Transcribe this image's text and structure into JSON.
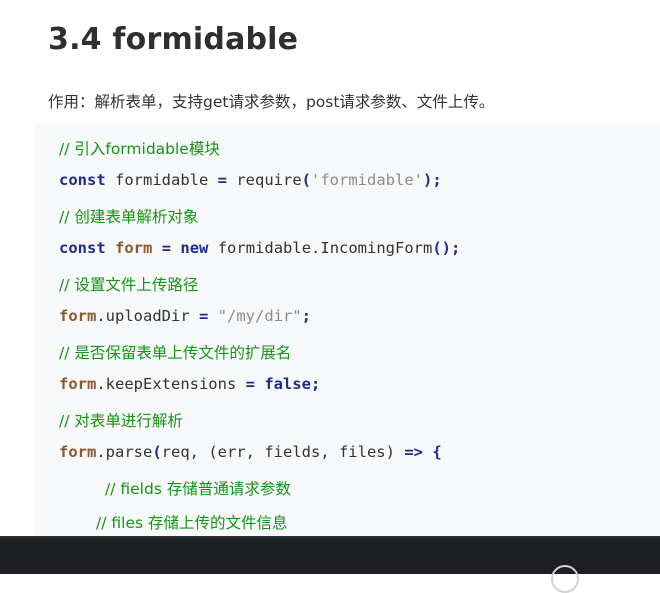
{
  "title": "3.4 formidable",
  "intro": "作用：解析表单，支持get请求参数，post请求参数、文件上传。",
  "code": {
    "c1": "// 引入formidable模块",
    "l1": {
      "kw": "const",
      "a": " formidable ",
      "op": "=",
      "b": " require",
      "paren_open": "(",
      "str": "'formidable'",
      "paren_close": ")",
      "semi": ";"
    },
    "c2": "// 创建表单解析对象",
    "l2": {
      "kw1": "const",
      "id": "form",
      "op": "=",
      "kw2": "new",
      "rest": " formidable.IncomingForm",
      "parens": "()",
      "semi": ";"
    },
    "c3": "// 设置文件上传路径",
    "l3": {
      "id": "form",
      "prop": ".uploadDir ",
      "op": "=",
      "str": " \"/my/dir\"",
      "semi": ";"
    },
    "c4": "// 是否保留表单上传文件的扩展名",
    "l4": {
      "id": "form",
      "prop": ".keepExtensions ",
      "op": "=",
      "kw": " false",
      "semi": ";"
    },
    "c5": "// 对表单进行解析",
    "l5": {
      "id": "form",
      "prop": ".parse",
      "paren_open": "(",
      "args": "req, (err, fields, files) ",
      "arrow": "=>",
      "brace": " {"
    },
    "c6": "// fields 存储普通请求参数",
    "c7": "// files 存储上传的文件信息"
  },
  "colors": {
    "comment": "#149614",
    "keyword": "#1d2c8a",
    "identifier": "#8a5a2b",
    "string": "#8c8c8c",
    "code_background": "#f6f8fa",
    "dark_bar": "#1e1f22"
  },
  "icons": {
    "bottom_bar_control": "circle-icon"
  }
}
